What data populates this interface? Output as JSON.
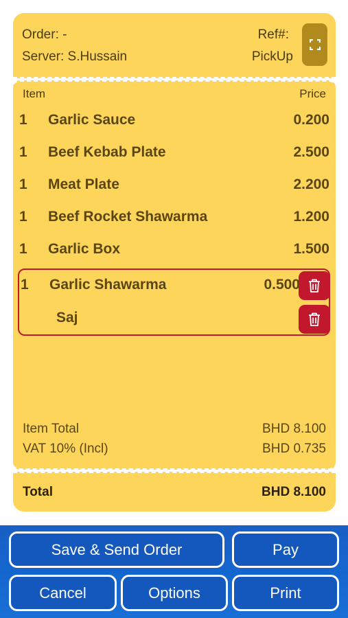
{
  "header": {
    "order_label": "Order: -",
    "server_label": "Server: S.Hussain",
    "ref_label": "Ref#:",
    "mode_label": "PickUp",
    "expand_icon": "expand-icon"
  },
  "items": {
    "col_item": "Item",
    "col_price": "Price",
    "rows": [
      {
        "qty": "1",
        "name": "Garlic Sauce",
        "price": "0.200"
      },
      {
        "qty": "1",
        "name": "Beef Kebab Plate",
        "price": "2.500"
      },
      {
        "qty": "1",
        "name": "Meat Plate",
        "price": "2.200"
      },
      {
        "qty": "1",
        "name": "Beef Rocket Shawarma",
        "price": "1.200"
      },
      {
        "qty": "1",
        "name": "Garlic Box",
        "price": "1.500"
      }
    ],
    "selected": {
      "qty": "1",
      "name": "Garlic Shawarma",
      "price": "0.500",
      "modifier": "Saj"
    }
  },
  "summary": {
    "item_total_label": "Item Total",
    "item_total_value": "BHD  8.100",
    "vat_label": "VAT 10% (Incl)",
    "vat_value": "BHD  0.735",
    "total_label": "Total",
    "total_value": "BHD  8.100"
  },
  "footer": {
    "save_send": "Save & Send Order",
    "pay": "Pay",
    "cancel": "Cancel",
    "options": "Options",
    "print": "Print"
  },
  "colors": {
    "card": "#fdd55a",
    "accent_red": "#c2182e",
    "footer_blue": "#1558bd",
    "expand_btn": "#b08a1c"
  }
}
